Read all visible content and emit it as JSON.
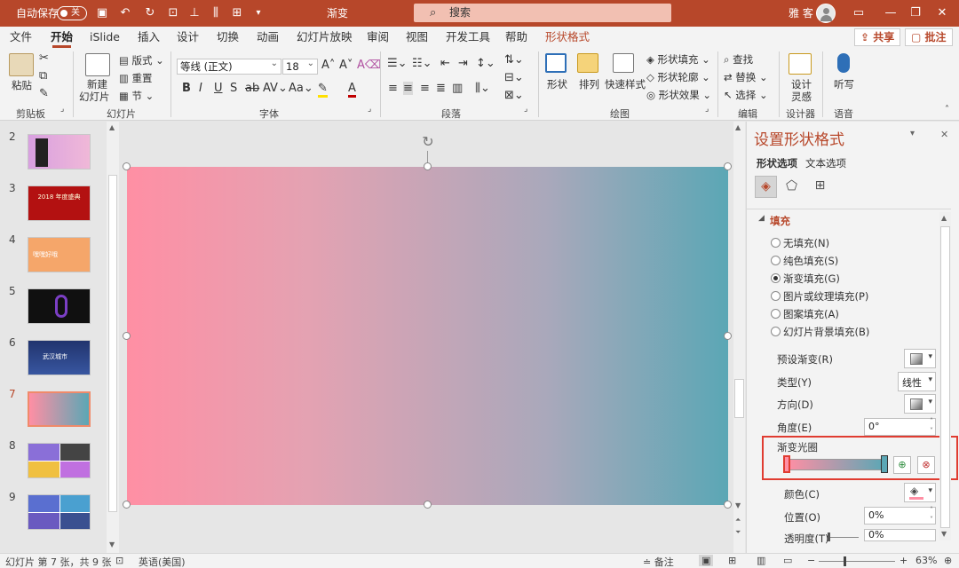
{
  "titlebar": {
    "autosave_label": "自动保存",
    "autosave_state": "关",
    "doc_title": "渐变",
    "search_placeholder": "搜索",
    "user_name": "雅 客"
  },
  "tabs": [
    "文件",
    "开始",
    "iSlide",
    "插入",
    "设计",
    "切换",
    "动画",
    "幻灯片放映",
    "审阅",
    "视图",
    "开发工具",
    "帮助",
    "形状格式"
  ],
  "share_label": "共享",
  "comment_label": "批注",
  "ribbon": {
    "clipboard": {
      "paste": "粘贴",
      "group": "剪贴板"
    },
    "slides": {
      "new_slide_1": "新建",
      "new_slide_2": "幻灯片",
      "layout": "版式",
      "reset": "重置",
      "section": "节",
      "group": "幻灯片"
    },
    "font": {
      "family": "等线 (正文)",
      "size": "18",
      "group": "字体"
    },
    "paragraph": {
      "group": "段落"
    },
    "drawing": {
      "shapes": "形状",
      "arrange": "排列",
      "quick_styles": "快速样式",
      "shape_fill": "形状填充",
      "shape_outline": "形状轮廓",
      "shape_effects": "形状效果",
      "group": "绘图"
    },
    "editing": {
      "find": "查找",
      "replace": "替换",
      "select": "选择",
      "group": "编辑"
    },
    "designer": {
      "label_1": "设计",
      "label_2": "灵感",
      "group": "设计器"
    },
    "voice": {
      "label": "听写",
      "group": "语音"
    }
  },
  "thumbnails": [
    {
      "num": "2",
      "title": ""
    },
    {
      "num": "3",
      "title": "2018 年度盛典"
    },
    {
      "num": "4",
      "title": "嘿嘿好哦"
    },
    {
      "num": "5",
      "title": ""
    },
    {
      "num": "6",
      "title": "武汉城市"
    },
    {
      "num": "7",
      "title": ""
    },
    {
      "num": "8",
      "title": ""
    },
    {
      "num": "9",
      "title": ""
    }
  ],
  "pane": {
    "title": "设置形状格式",
    "tab_shape": "形状选项",
    "tab_text": "文本选项",
    "section_fill": "填充",
    "fill_options": [
      "无填充(N)",
      "纯色填充(S)",
      "渐变填充(G)",
      "图片或纹理填充(P)",
      "图案填充(A)",
      "幻灯片背景填充(B)"
    ],
    "selected_fill": 2,
    "preset_label": "预设渐变(R)",
    "type_label": "类型(Y)",
    "type_value": "线性",
    "direction_label": "方向(D)",
    "angle_label": "角度(E)",
    "angle_value": "0°",
    "stops_label": "渐变光圈",
    "color_label": "颜色(C)",
    "position_label": "位置(O)",
    "position_value": "0%",
    "transparency_label": "透明度(T)",
    "transparency_value": "0%"
  },
  "status": {
    "slide_info": "幻灯片 第 7 张，共 9 张",
    "language": "英语(美国)",
    "notes": "备注",
    "zoom": "63%"
  },
  "colors": {
    "accent": "#b7472a",
    "gradient_start": "#ff8fa4",
    "gradient_end": "#5ba7b5",
    "highlight_box": "#e03c31"
  }
}
